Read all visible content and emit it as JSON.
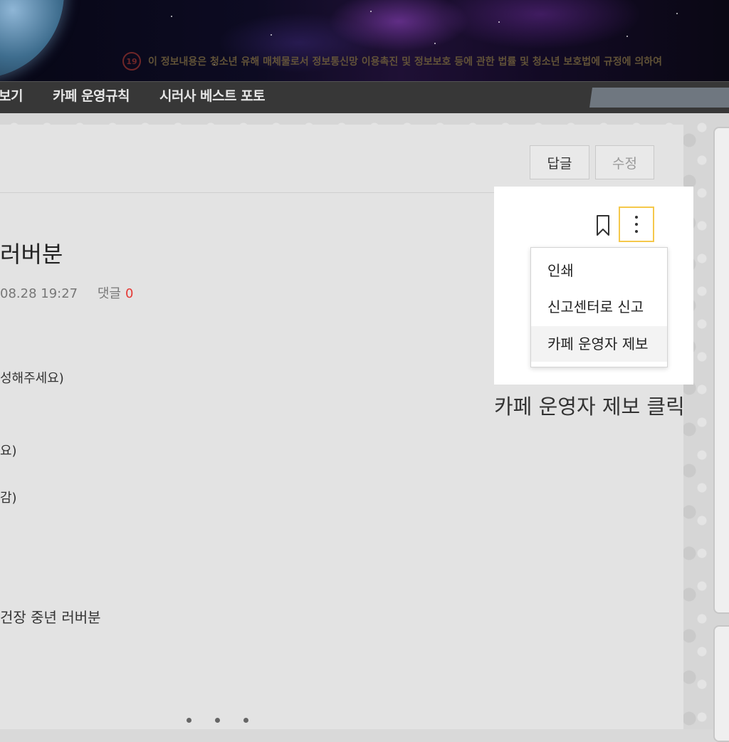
{
  "banner": {
    "age_badge": "19",
    "warning_text": "이 정보내용은 청소년 유해 매체물로서 정보통신망 이용촉진 및 정보보호 등에 관한 법률 및 청소년 보호법에 규정에 의하여"
  },
  "nav": {
    "items": [
      "보기",
      "카페 운영규칙",
      "시러사 베스트 포토"
    ]
  },
  "article": {
    "reply_label": "답글",
    "edit_label": "수정",
    "title": "러버분",
    "date": "08.28 19:27",
    "comment_label": "댓글",
    "comment_count": "0",
    "lines": [
      "성해주세요)",
      "요)",
      "감)",
      "건장 중년 러버분"
    ]
  },
  "menu": {
    "items": [
      "인쇄",
      "신고센터로 신고",
      "카페 운영자 제보"
    ]
  },
  "caption": "카페 운영자 제보 클릭",
  "icons": {
    "bookmark": "bookmark-icon",
    "more": "more-vertical-icon"
  },
  "colors": {
    "highlight_border": "#f5c84b",
    "comment_count": "#e53935",
    "nav_bg": "#373737"
  }
}
